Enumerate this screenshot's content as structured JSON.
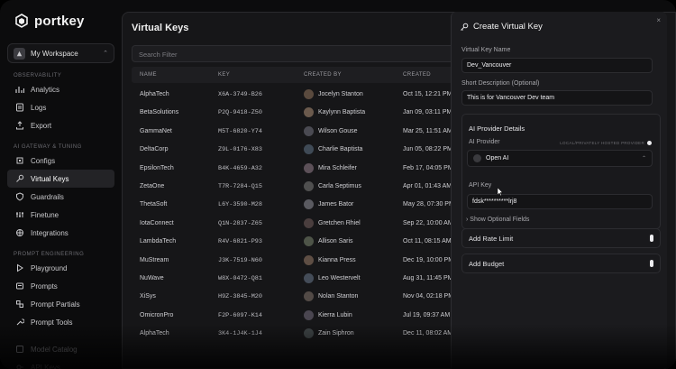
{
  "brand": {
    "name": "portkey"
  },
  "workspace": {
    "name": "My Workspace"
  },
  "sidebar": {
    "sections": [
      {
        "label": "OBSERVABILITY",
        "items": [
          {
            "label": "Analytics",
            "icon": "chart-icon"
          },
          {
            "label": "Logs",
            "icon": "logs-icon"
          },
          {
            "label": "Export",
            "icon": "export-icon"
          }
        ]
      },
      {
        "label": "AI GATEWAY & TUNING",
        "items": [
          {
            "label": "Configs",
            "icon": "configs-icon"
          },
          {
            "label": "Virtual Keys",
            "icon": "key-icon",
            "active": true
          },
          {
            "label": "Guardrails",
            "icon": "shield-icon"
          },
          {
            "label": "Finetune",
            "icon": "finetune-icon"
          },
          {
            "label": "Integrations",
            "icon": "integrations-icon"
          }
        ]
      },
      {
        "label": "PROMPT ENGINEERING",
        "items": [
          {
            "label": "Playground",
            "icon": "playground-icon"
          },
          {
            "label": "Prompts",
            "icon": "prompts-icon"
          },
          {
            "label": "Prompt Partials",
            "icon": "partials-icon"
          },
          {
            "label": "Prompt Tools",
            "icon": "tools-icon"
          }
        ]
      }
    ],
    "extra_items": [
      {
        "label": "Model Catalog",
        "icon": "catalog-icon"
      },
      {
        "label": "API Keys",
        "icon": "api-keys-icon"
      }
    ]
  },
  "main": {
    "title": "Virtual Keys",
    "search_placeholder": "Search Filter",
    "columns": [
      "NAME",
      "KEY",
      "CREATED BY",
      "CREATED"
    ],
    "rows": [
      {
        "name": "AlphaTech",
        "key": "X6A-3749-B26",
        "created_by": "Jocelyn Stanton",
        "created": "Oct 15, 12:21 PM"
      },
      {
        "name": "BetaSolutions",
        "key": "P2Q-9418-Z50",
        "created_by": "Kaylynn Baptista",
        "created": "Jan 09, 03:11 PM"
      },
      {
        "name": "GammaNet",
        "key": "M5T-6820-Y74",
        "created_by": "Wilson Gouse",
        "created": "Mar 25, 11:51 AM"
      },
      {
        "name": "DeltaCorp",
        "key": "Z9L-0176-X83",
        "created_by": "Charlie Baptista",
        "created": "Jun 05, 08:22 PM"
      },
      {
        "name": "EpsilonTech",
        "key": "B4K-4659-A32",
        "created_by": "Mira Schleifer",
        "created": "Feb 17, 04:05 PM"
      },
      {
        "name": "ZetaOne",
        "key": "T7R-7284-Q15",
        "created_by": "Carla Septimus",
        "created": "Apr 01, 01:43 AM"
      },
      {
        "name": "ThetaSoft",
        "key": "L6Y-3590-M28",
        "created_by": "James Bator",
        "created": "May 28, 07:30 PM"
      },
      {
        "name": "IotaConnect",
        "key": "Q1N-2837-Z65",
        "created_by": "Gretchen Rhiel",
        "created": "Sep 22, 10:00 AM"
      },
      {
        "name": "LambdaTech",
        "key": "R4V-6821-P93",
        "created_by": "Allison Saris",
        "created": "Oct 11, 08:15 AM"
      },
      {
        "name": "MuStream",
        "key": "J3K-7519-N60",
        "created_by": "Kianna Press",
        "created": "Dec 19, 10:00 PM"
      },
      {
        "name": "NuWave",
        "key": "W8X-0472-Q81",
        "created_by": "Leo Westervelt",
        "created": "Aug 31, 11:45 PM"
      },
      {
        "name": "XiSys",
        "key": "H9Z-3845-M20",
        "created_by": "Nolan Stanton",
        "created": "Nov 04, 02:18 PM"
      },
      {
        "name": "OmicronPro",
        "key": "F2P-6097-K14",
        "created_by": "Kierra Lubin",
        "created": "Jul 19, 09:37 AM"
      },
      {
        "name": "AlphaTech",
        "key": "3K4-1J4K-1J4",
        "created_by": "Zain Siphron",
        "created": "Dec 11, 08:02 AM"
      }
    ]
  },
  "drawer": {
    "title": "Create Virtual Key",
    "close_glyph": "×",
    "name_label": "Virtual Key Name",
    "name_value": "Dev_Vancouver",
    "desc_label": "Short Description (Optional)",
    "desc_value": "This is for Vancouver Dev team",
    "provider_section": "AI Provider Details",
    "provider_label": "AI Provider",
    "self_hosted_label": "LOCAL/PRIVATELY HOSTED PROVIDER",
    "provider_value": "Open AI",
    "api_key_label": "API Key",
    "api_key_value": "fdsk**********lrj8",
    "optional_fields": "Show Optional Fields",
    "rate_limit_label": "Add Rate Limit",
    "budget_label": "Add Budget"
  },
  "colors": {
    "background": "#0c0c0d",
    "panel": "#161618",
    "drawer": "#1b1b1e",
    "active_nav": "#232326"
  }
}
